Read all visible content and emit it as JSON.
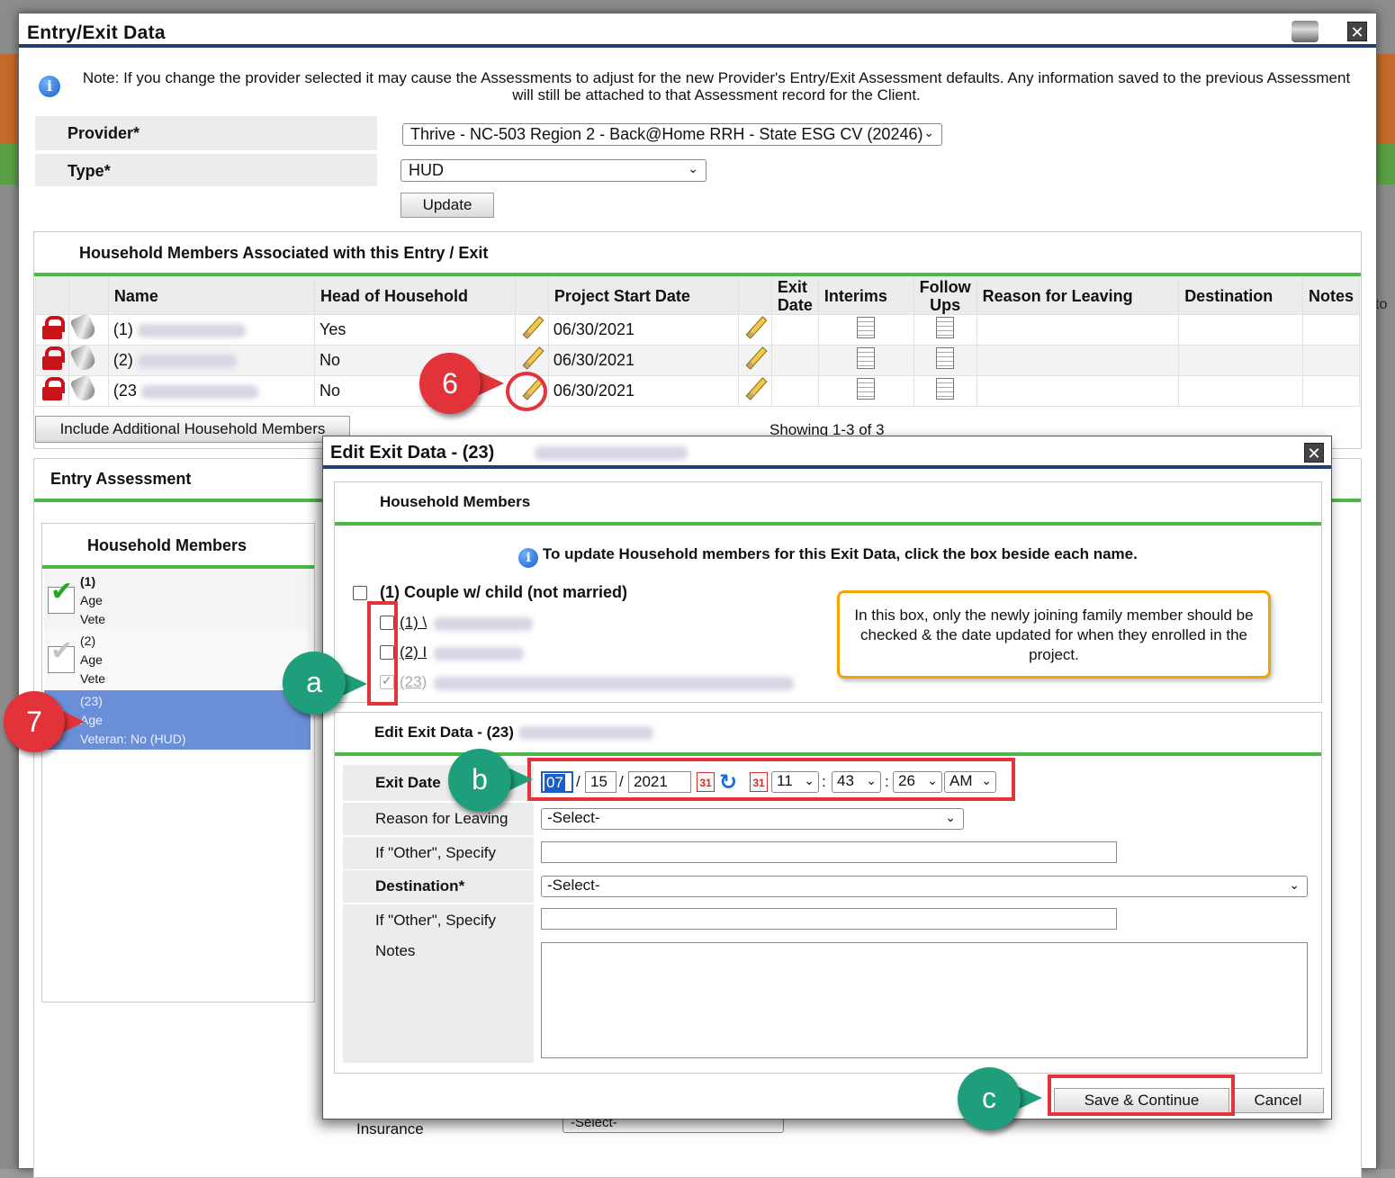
{
  "window": {
    "title": "Entry/Exit Data",
    "note": "Note: If you change the provider selected it may cause the Assessments to adjust for the new Provider's Entry/Exit Assessment defaults. Any information saved to the previous Assessment will still be attached to that Assessment record for the Client.",
    "provider_label": "Provider",
    "provider_value": "Thrive - NC-503 Region 2 - Back@Home RRH - State ESG CV (20246)",
    "type_label": "Type",
    "type_value": "HUD",
    "update_label": "Update",
    "required_mark": "*"
  },
  "household_table": {
    "title": "Household Members Associated with this Entry / Exit",
    "headers": [
      "Name",
      "Head of Household",
      "Project Start Date",
      "Exit Date",
      "Interims",
      "Follow Ups",
      "Reason for Leaving",
      "Destination",
      "Notes"
    ],
    "rows": [
      {
        "id": "(1)",
        "head": "Yes",
        "start": "06/30/2021"
      },
      {
        "id": "(2)",
        "head": "No",
        "start": "06/30/2021"
      },
      {
        "id": "(23",
        "head": "No",
        "start": "06/30/2021"
      }
    ],
    "include_button": "Include Additional Household Members",
    "showing": "Showing 1-3 of 3"
  },
  "entry_assessment": {
    "title": "Entry Assessment",
    "hm_title": "Household Members",
    "members": [
      {
        "id": "(1)",
        "age": "Age",
        "vet": "Vete"
      },
      {
        "id": "(2)",
        "age": "Age",
        "vet": "Vete"
      },
      {
        "id": "(23)",
        "age": "Age",
        "vet": "Veteran: No (HUD)"
      }
    ],
    "insurance_label": "Insurance",
    "insurance_value": "-Select-"
  },
  "dialog": {
    "title": "Edit Exit Data - (23)",
    "hm_section_title": "Household Members",
    "instruction": "To update Household members for this Exit Data, click the box beside each name.",
    "group_label": "(1) Couple w/ child (not married)",
    "members": [
      "(1) \\",
      "(2) I",
      "(23)"
    ],
    "edit_section_title": "Edit Exit Data - (23)",
    "exit_date_label": "Exit Date",
    "month": "07",
    "day": "15",
    "year": "2021",
    "hour": "11",
    "minute": "43",
    "second": "26",
    "ampm": "AM",
    "reason_label": "Reason for Leaving",
    "reason_value": "-Select-",
    "other1_label": "If \"Other\", Specify",
    "destination_label": "Destination",
    "destination_value": "-Select-",
    "other2_label": "If \"Other\", Specify",
    "notes_label": "Notes",
    "save_label": "Save & Continue",
    "cancel_label": "Cancel"
  },
  "annotations": {
    "tip_text": "In this box, only the newly joining family member should be checked & the date updated for when they enrolled in the project.",
    "callout_6": "6",
    "callout_7": "7",
    "callout_a": "a",
    "callout_b": "b",
    "callout_c": "c"
  },
  "background": {
    "right_edge_text": "to"
  },
  "colors": {
    "accent_green": "#4cb847",
    "title_bar_blue": "#1f3f6e",
    "callout_teal": "#1e9e7a",
    "callout_red": "#e2323a",
    "highlight_red": "#e2343a",
    "tip_border": "#f0a500",
    "selected_row": "#6b8fd6"
  }
}
